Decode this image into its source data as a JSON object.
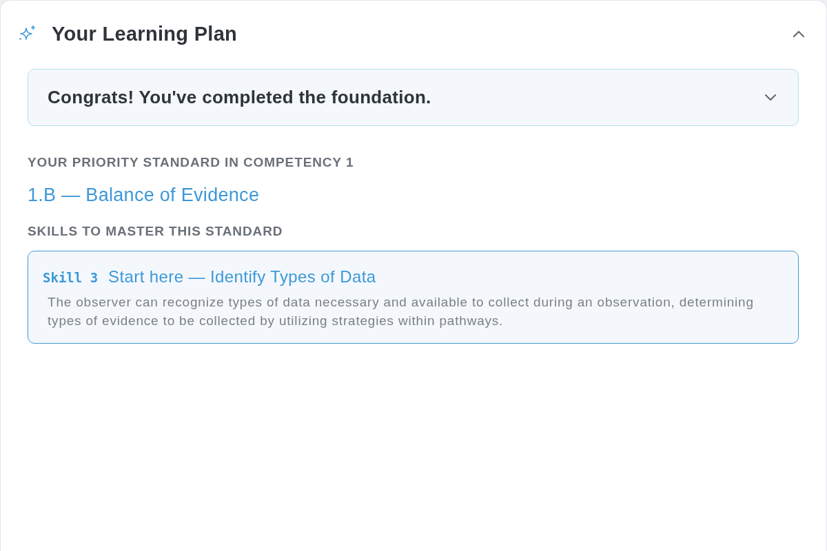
{
  "panel": {
    "title": "Your Learning Plan",
    "expanded": true
  },
  "notice": {
    "text": "Congrats! You've completed the foundation.",
    "expanded": false
  },
  "priority_standard": {
    "label": "YOUR PRIORITY STANDARD IN COMPETENCY 1",
    "name": "1.B — Balance of Evidence"
  },
  "skills_section": {
    "label": "SKILLS TO MASTER THIS STANDARD",
    "skills": [
      {
        "tag": "Skill 3",
        "title": "Start here — Identify Types of Data",
        "description": "The observer can recognize types of data necessary and available to collect during an observation, determining types of evidence to be collected by utilizing strategies within pathways.",
        "selected": true
      }
    ]
  }
}
